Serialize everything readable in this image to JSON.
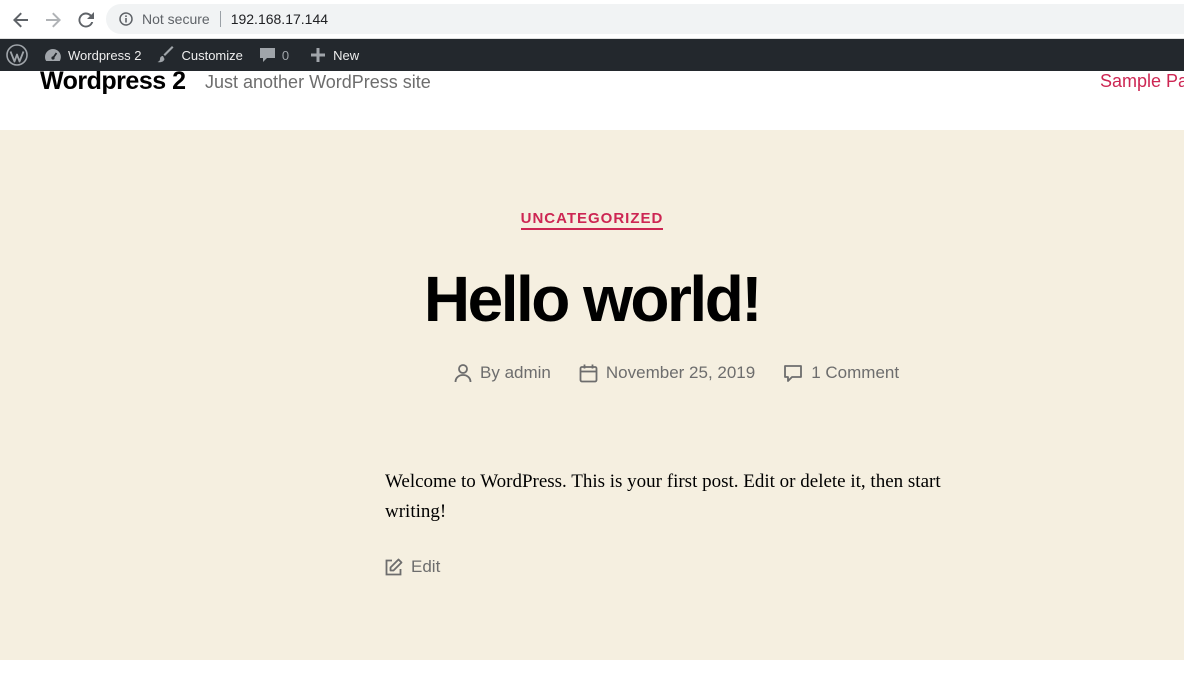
{
  "browser": {
    "security_label": "Not secure",
    "url": "192.168.17.144"
  },
  "adminbar": {
    "site_name": "Wordpress 2",
    "customize": "Customize",
    "comments_count": "0",
    "new_label": "New"
  },
  "site": {
    "title": "Wordpress 2",
    "description": "Just another WordPress site",
    "nav_item": "Sample Pa"
  },
  "post": {
    "category": "UNCATEGORIZED",
    "title": "Hello world!",
    "author_prefix": "By",
    "author": "admin",
    "date": "November 25, 2019",
    "comments": "1 Comment",
    "content": "Welcome to WordPress. This is your first post. Edit or delete it, then start writing!",
    "edit_label": "Edit"
  },
  "colors": {
    "accent": "#cd2653",
    "hero_bg": "#f5efe0",
    "adminbar_bg": "#23282d"
  }
}
